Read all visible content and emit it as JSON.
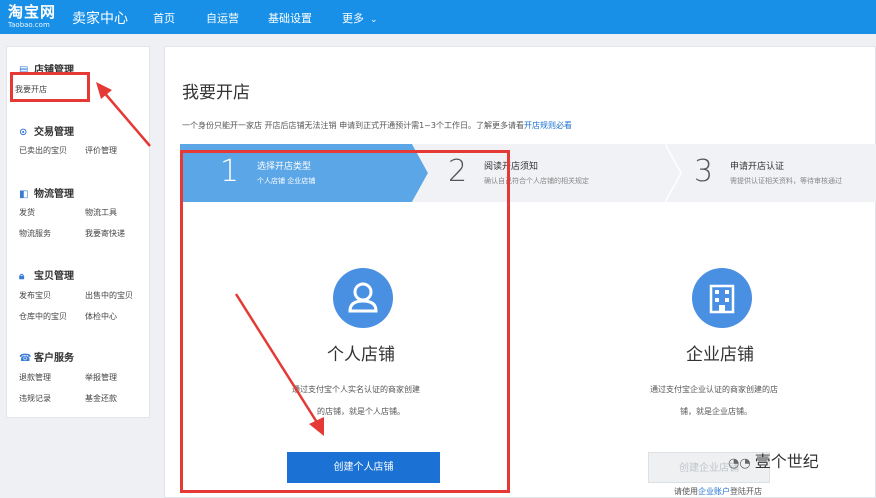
{
  "topbar": {
    "logo_main": "淘宝网",
    "logo_sub": "Taobao.com",
    "seller_center": "卖家中心",
    "nav": [
      "首页",
      "自运营",
      "基础设置",
      "更多"
    ]
  },
  "sidebar": {
    "groups": [
      {
        "title": "店铺管理",
        "items": [
          "我要开店"
        ]
      },
      {
        "title": "交易管理",
        "items": [
          "已卖出的宝贝",
          "评价管理"
        ]
      },
      {
        "title": "物流管理",
        "items": [
          "发货",
          "物流工具",
          "物流服务",
          "我要寄快递"
        ]
      },
      {
        "title": "宝贝管理",
        "items": [
          "发布宝贝",
          "出售中的宝贝",
          "仓库中的宝贝",
          "体检中心"
        ]
      },
      {
        "title": "客户服务",
        "items": [
          "退款管理",
          "举报管理",
          "违规记录",
          "基金还款"
        ]
      }
    ]
  },
  "main": {
    "title": "我要开店",
    "notice": "一个身份只能开一家店 开店后店铺无法注销 申请到正式开通预计需1~3个工作日。了解更多请看",
    "notice_link": "开店规则必看",
    "steps": [
      {
        "num": "1",
        "title": "选择开店类型",
        "desc": "个人店铺 企业店铺"
      },
      {
        "num": "2",
        "title": "阅读开店须知",
        "desc": "确认自己符合个人店铺的相关规定"
      },
      {
        "num": "3",
        "title": "申请开店认证",
        "desc": "需提供认证相关资料，等待审核通过"
      }
    ],
    "personal": {
      "title": "个人店铺",
      "desc1": "通过支付宝个人实名认证的商家创建",
      "desc2": "的店铺，就是个人店铺。",
      "button": "创建个人店铺"
    },
    "enterprise": {
      "title": "企业店铺",
      "desc1": "通过支付宝企业认证的商家创建的店",
      "desc2": "铺，就是企业店铺。",
      "button": "创建企业店铺",
      "note_prefix": "请使用",
      "note_link": "企业账户",
      "note_suffix": "登陆开店"
    }
  },
  "watermark": "壹个世纪",
  "colors": {
    "topbar": "#1890e8",
    "accent": "#1b72d4",
    "highlight": "#e53935",
    "step_active": "#5aa6e6"
  }
}
